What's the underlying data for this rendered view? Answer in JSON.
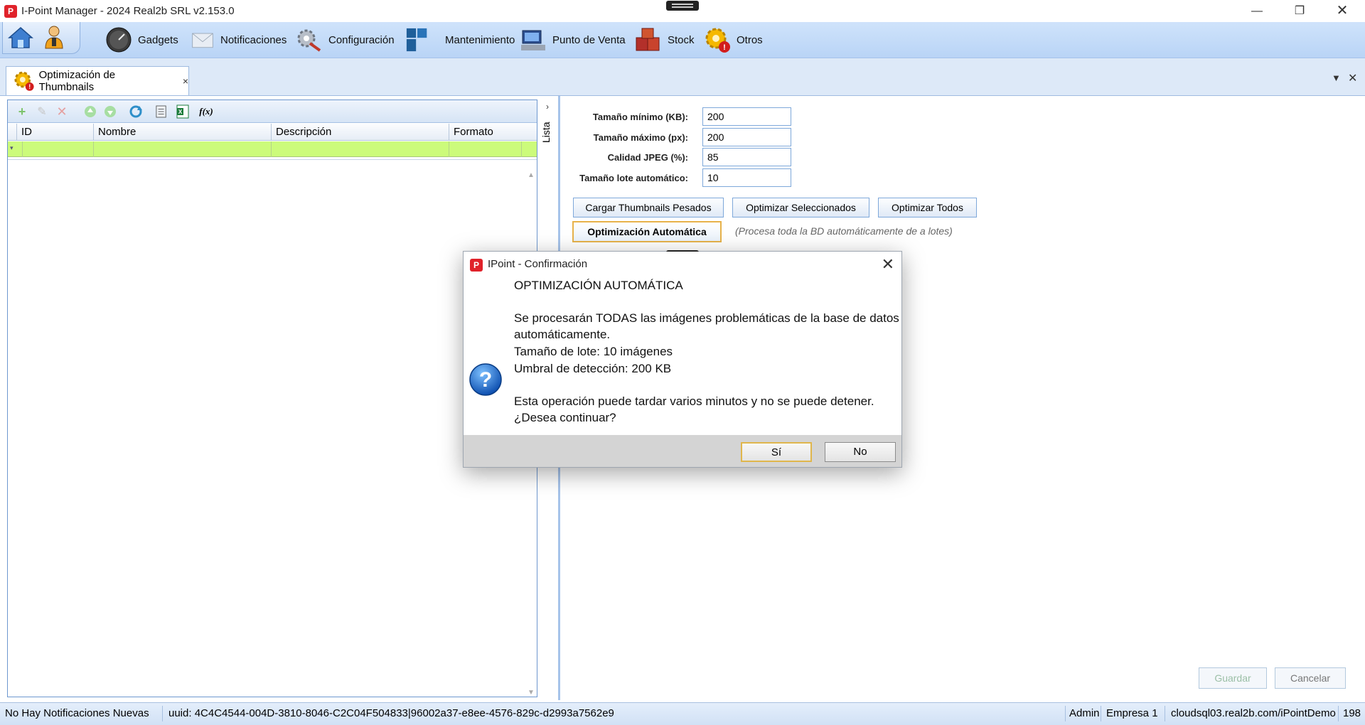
{
  "window": {
    "title": "I-Point Manager - 2024 Real2b SRL v2.153.0",
    "app_icon_letter": "P"
  },
  "ribbon": {
    "items": [
      {
        "label": "Gadgets",
        "icon": "gauge-icon"
      },
      {
        "label": "Notificaciones",
        "icon": "envelope-icon"
      },
      {
        "label": "Configuración",
        "icon": "gears-icon"
      },
      {
        "label": "Mantenimiento",
        "icon": "blocks-icon"
      },
      {
        "label": "Punto de Venta",
        "icon": "pos-terminal-icon"
      },
      {
        "label": "Stock",
        "icon": "boxes-icon"
      },
      {
        "label": "Otros",
        "icon": "gear-alert-icon"
      }
    ]
  },
  "tab": {
    "label": "Optimización de Thumbnails",
    "close": "×"
  },
  "grid": {
    "columns": [
      "ID",
      "Nombre",
      "Descripción",
      "Formato"
    ]
  },
  "side_strip": {
    "label": "Lista"
  },
  "form": {
    "min_size_label": "Tamaño mínimo (KB):",
    "min_size_value": "200",
    "max_size_label": "Tamaño máximo (px):",
    "max_size_value": "200",
    "jpeg_quality_label": "Calidad JPEG (%):",
    "jpeg_quality_value": "85",
    "batch_size_label": "Tamaño lote automático:",
    "batch_size_value": "10",
    "load_heavy_button": "Cargar Thumbnails Pesados",
    "optimize_selected_button": "Optimizar Seleccionados",
    "optimize_all_button": "Optimizar Todos",
    "auto_optimize_button": "Optimización Automática",
    "auto_hint": "(Procesa toda la BD automáticamente de a lotes)",
    "save_button": "Guardar",
    "cancel_button": "Cancelar"
  },
  "statusbar": {
    "notifications": "No Hay Notificaciones Nuevas",
    "uuid": "uuid: 4C4C4544-004D-3810-8046-C2C04F504833|96002a37-e8ee-4576-829c-d2993a7562e9",
    "user": "Admin",
    "company": "Empresa 1",
    "server": "cloudsql03.real2b.com/iPointDemo",
    "extra": "198"
  },
  "dialog": {
    "title": "IPoint - Confirmación",
    "heading": "OPTIMIZACIÓN AUTOMÁTICA",
    "line1": "Se procesarán TODAS las imágenes problemáticas de la base de datos",
    "line2": "automáticamente.",
    "line3": "Tamaño de lote: 10 imágenes",
    "line4": "Umbral de detección: 200 KB",
    "line5": "Esta operación puede tardar varios minutos y no se puede detener.",
    "line6": "¿Desea continuar?",
    "yes_button": "Sí",
    "no_button": "No"
  }
}
